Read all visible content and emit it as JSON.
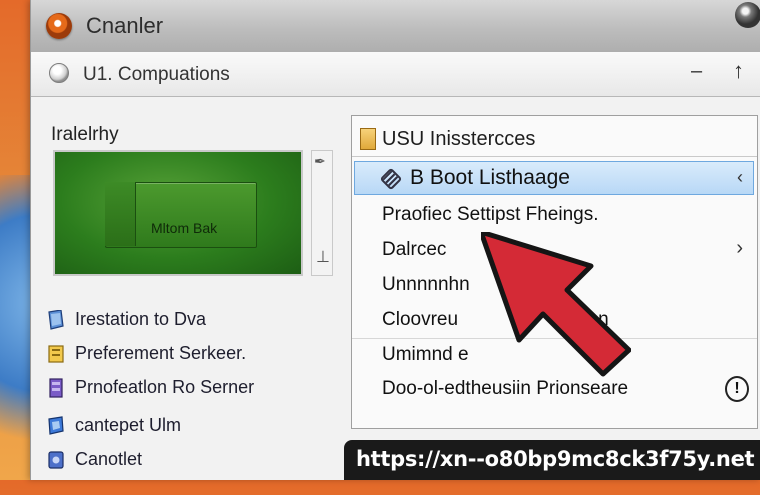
{
  "window": {
    "title": "Cnanler",
    "icons": {
      "app": "app-orb-icon",
      "window_orb": "window-orb-icon"
    }
  },
  "navbar": {
    "title": "U1. Compuations",
    "minimize_glyph": "–",
    "up_glyph": "↑"
  },
  "left_pane": {
    "heading": "Iralelrhy",
    "preview_label": "Mltom Bak",
    "items": [
      {
        "label": "Irestation to Dva",
        "icon": "drive-icon"
      },
      {
        "label": "Preferement Serkeer.",
        "icon": "settings-icon"
      },
      {
        "label": "Prnofeatlon Ro Serner",
        "icon": "server-icon"
      },
      {
        "label": "cantepet Ulm",
        "icon": "computer-icon"
      },
      {
        "label": "Canotlet",
        "icon": "control-icon"
      }
    ]
  },
  "right_pane": {
    "header": "USU Inisstercces",
    "selected_item": "B Boot Listhaage",
    "items": [
      "Praofiec Settipst Fheings.",
      "Dalrcec",
      "Unnnnnhn",
      "Cloovreu",
      "Umimnd e",
      "Doo-ol-edtheusiin Prionseare"
    ],
    "pen_text": "gen",
    "colors": {
      "selection_fill": "#c8e1f9",
      "selection_border": "#6ea8df"
    }
  },
  "overlay": {
    "cursor_color": "#d42a36",
    "url": "https://xn--o80bp9mc8ck3f75y.net"
  }
}
